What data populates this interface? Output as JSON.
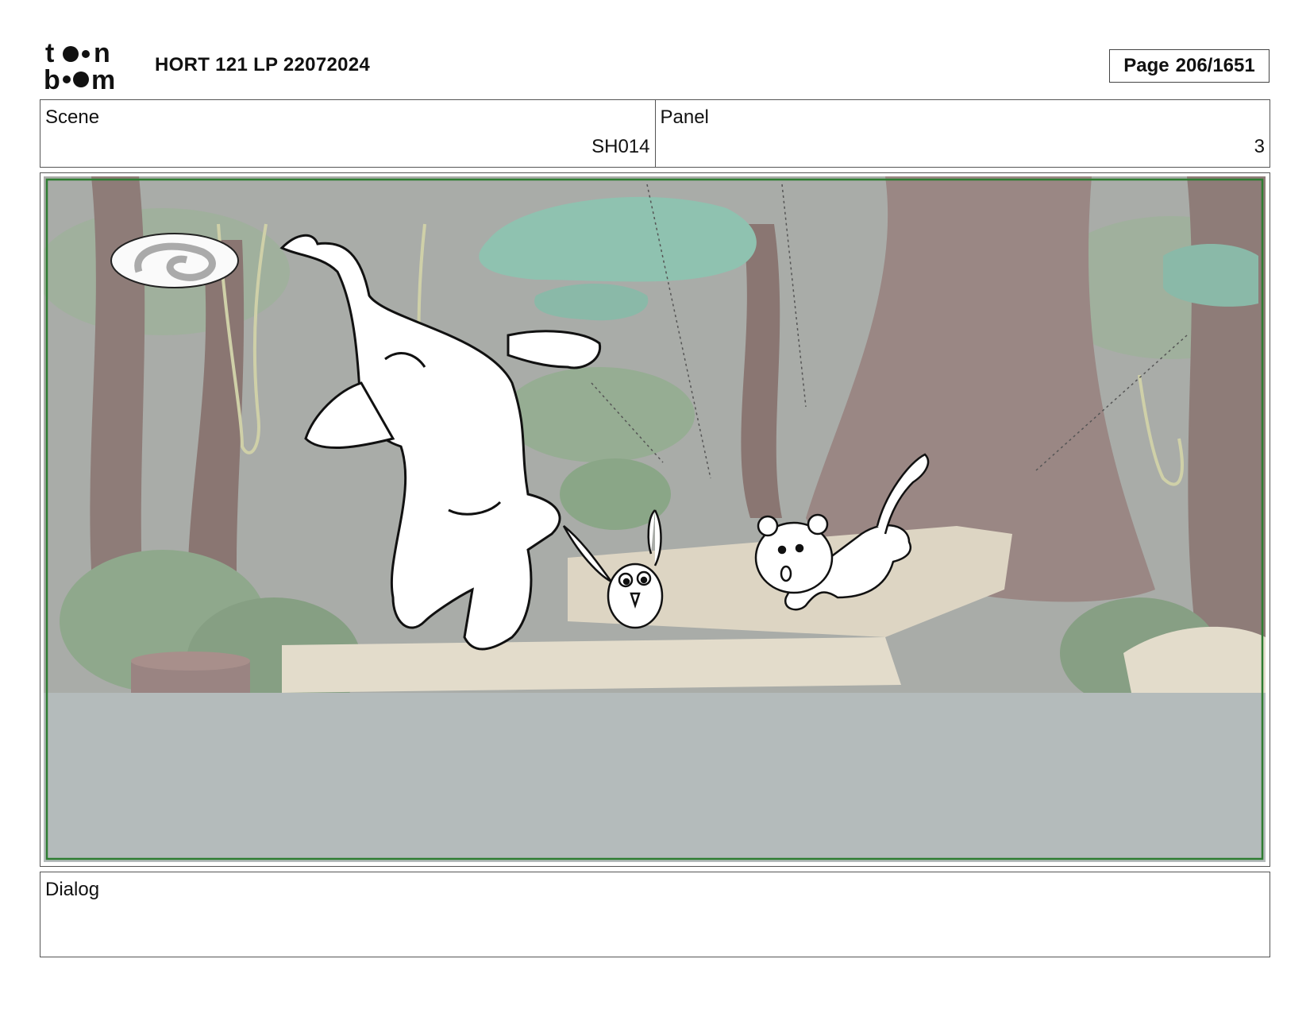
{
  "header": {
    "logo_text": "toon boom",
    "title": "HORT 121 LP 22072024",
    "page_label": "Page",
    "page_value": "206/1651"
  },
  "info": {
    "scene_label": "Scene",
    "scene_value": "SH014",
    "panel_label": "Panel",
    "panel_value": "3"
  },
  "dialog": {
    "label": "Dialog",
    "text": ""
  },
  "colors": {
    "safe_frame": "#2e7d32",
    "sky": "#a9aca8",
    "ground": "#b4bbbb",
    "trunk": "#8e7c78",
    "foliage": "#8fa88c",
    "canopy": "#8fc2b0",
    "rock": "#e3dccb"
  }
}
